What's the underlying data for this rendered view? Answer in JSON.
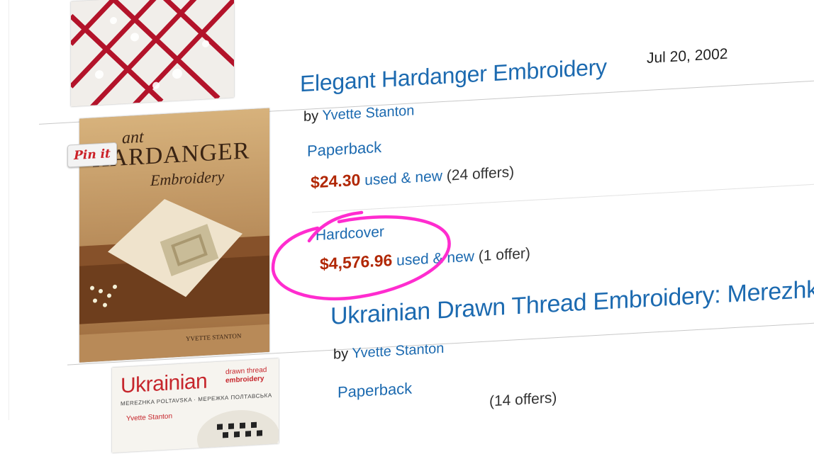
{
  "results": [
    {
      "title": "Elegant Hardanger Embroidery",
      "date": "Jul 20, 2002",
      "by_label": "by",
      "author": "Yvette Stanton",
      "cover": {
        "title_top": "ant",
        "title_main": "HARDANGER",
        "title_sub": "Embroidery",
        "author": "YVETTE STANTON"
      },
      "formats": [
        {
          "format": "Paperback",
          "price": "$24.30",
          "used_new": "used & new",
          "offers": "(24 offers)"
        },
        {
          "format": "Hardcover",
          "price": "$4,576.96",
          "used_new": "used & new",
          "offers": "(1 offer)"
        }
      ]
    },
    {
      "title": "Ukrainian Drawn Thread Embroidery: Merezhk",
      "by_label": "by",
      "author": "Yvette Stanton",
      "cover": {
        "title_main": "Ukrainian",
        "title_side_1": "drawn thread",
        "title_side_2": "embroidery",
        "subtitle": "MEREZHKA POLTAVSKA · МЕРЕЖКА ПОЛТАВСЬКА",
        "author": "Yvette Stanton"
      },
      "formats": [
        {
          "format": "Paperback",
          "offers": "(14 offers)"
        }
      ]
    }
  ],
  "pin_button": {
    "label": "Pin it"
  },
  "colors": {
    "link": "#1c6ab0",
    "price": "#b12704",
    "annotation": "#ff2ccf",
    "pin": "#cb2027"
  },
  "icons": {
    "pin_it": "pinterest-pin-it-icon"
  }
}
